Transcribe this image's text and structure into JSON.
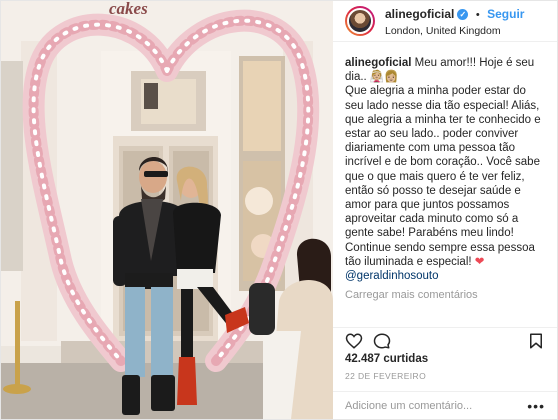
{
  "photo": {
    "sign_text": "cakes"
  },
  "header": {
    "username": "alinegoficial",
    "follow_label": "Seguir",
    "location": "London, United Kingdom",
    "verified_icon": "verified-badge-icon"
  },
  "caption": {
    "username": "alinegoficial",
    "text_1": "Meu amor!!! Hoje é seu dia.. 👰🏼👩🏼",
    "text_2": "Que alegria a minha poder estar do seu lado nesse dia tão especial! Aliás, que alegria a minha ter te conhecido e estar ao seu lado.. poder conviver diariamente com uma pessoa tão incrível e de bom coração.. Você sabe que o que mais quero é te ver feliz, então só posso te desejar saúde e amor para que juntos possamos aproveitar cada minuto como só a gente sabe! Parabéns meu lindo! Continue sendo sempre essa pessoa tão iluminada e especial!",
    "heart": "❤",
    "mention": "@geraldinhosouto"
  },
  "load_more": "Carregar mais comentários",
  "actions": {
    "like_icon": "heart-outline-icon",
    "comment_icon": "comment-bubble-icon",
    "save_icon": "bookmark-icon"
  },
  "likes": "42.487 curtidas",
  "date": "22 DE FEVEREIRO",
  "comment_box": {
    "placeholder": "Adicione um comentário...",
    "more": "•••"
  },
  "colors": {
    "link_blue": "#3897f0",
    "mention": "#003569",
    "heart_red": "#ed4956",
    "muted": "#999999"
  }
}
